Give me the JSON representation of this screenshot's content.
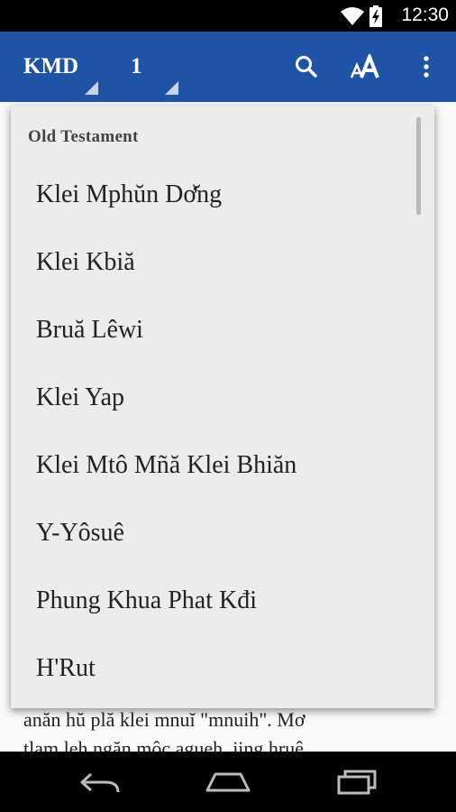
{
  "status_bar": {
    "time": "12:30"
  },
  "app_bar": {
    "version_label": "KMD",
    "chapter_label": "1",
    "color": "#1f53a6"
  },
  "book_menu": {
    "section_title": "Old Testament",
    "books": [
      "Klei Mphŭn Dơ̆ng",
      "Klei Kbiă",
      "Bruă Lêwi",
      "Klei Yap",
      "Klei Mtô Mñă Klei Bhiăn",
      "Y-Yôsuê",
      "Phung Khua Phat Kđi",
      "H'Rut"
    ]
  },
  "background_text": [
    "anăn hŭ plă klei mnuĭ \"mnuih\". Mơ",
    "tlam leh ngăn môc agueh. jing hruê"
  ]
}
